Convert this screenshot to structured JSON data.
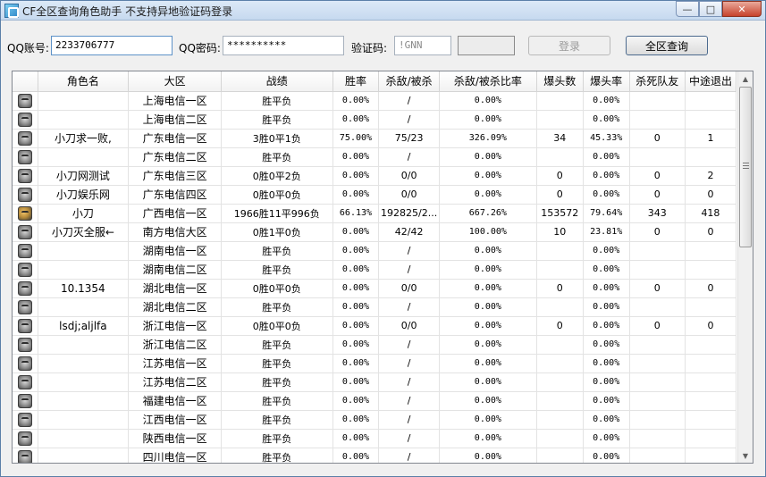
{
  "window": {
    "title": "CF全区查询角色助手 不支持异地验证码登录",
    "minimize": "—",
    "maximize": "□",
    "close": "✕"
  },
  "login": {
    "qq_label": "QQ账号:",
    "qq_value": "2233706777",
    "password_label": "QQ密码:",
    "password_value": "**********",
    "captcha_label": "验证码:",
    "captcha_value": "!GNN",
    "login_button": "登录",
    "query_button": "全区查询"
  },
  "table": {
    "columns": [
      "",
      "角色名",
      "大区",
      "战绩",
      "胜率",
      "杀敌/被杀",
      "杀敌/被杀比率",
      "爆头数",
      "爆头率",
      "杀死队友",
      "中途退出"
    ],
    "rows": [
      {
        "name": "",
        "region": "上海电信一区",
        "record": "胜平负",
        "win": "0.00%",
        "kd": "/",
        "kdr": "0.00%",
        "hs": "",
        "hsr": "0.00%",
        "tk": "",
        "quit": ""
      },
      {
        "name": "",
        "region": "上海电信二区",
        "record": "胜平负",
        "win": "0.00%",
        "kd": "/",
        "kdr": "0.00%",
        "hs": "",
        "hsr": "0.00%",
        "tk": "",
        "quit": ""
      },
      {
        "name": "小刀求一败,",
        "region": "广东电信一区",
        "record": "3胜0平1负",
        "win": "75.00%",
        "kd": "75/23",
        "kdr": "326.09%",
        "hs": "34",
        "hsr": "45.33%",
        "tk": "0",
        "quit": "1"
      },
      {
        "name": "",
        "region": "广东电信二区",
        "record": "胜平负",
        "win": "0.00%",
        "kd": "/",
        "kdr": "0.00%",
        "hs": "",
        "hsr": "0.00%",
        "tk": "",
        "quit": ""
      },
      {
        "name": "小刀网测试",
        "region": "广东电信三区",
        "record": "0胜0平2负",
        "win": "0.00%",
        "kd": "0/0",
        "kdr": "0.00%",
        "hs": "0",
        "hsr": "0.00%",
        "tk": "0",
        "quit": "2"
      },
      {
        "name": "小刀娱乐网",
        "region": "广东电信四区",
        "record": "0胜0平0负",
        "win": "0.00%",
        "kd": "0/0",
        "kdr": "0.00%",
        "hs": "0",
        "hsr": "0.00%",
        "tk": "0",
        "quit": "0"
      },
      {
        "name": "小刀",
        "region": "广西电信一区",
        "record": "1966胜11平996负",
        "win": "66.13%",
        "kd": "192825/2...",
        "kdr": "667.26%",
        "hs": "153572",
        "hsr": "79.64%",
        "tk": "343",
        "quit": "418",
        "special": true
      },
      {
        "name": "小刀灭全服←",
        "region": "南方电信大区",
        "record": "0胜1平0负",
        "win": "0.00%",
        "kd": "42/42",
        "kdr": "100.00%",
        "hs": "10",
        "hsr": "23.81%",
        "tk": "0",
        "quit": "0"
      },
      {
        "name": "",
        "region": "湖南电信一区",
        "record": "胜平负",
        "win": "0.00%",
        "kd": "/",
        "kdr": "0.00%",
        "hs": "",
        "hsr": "0.00%",
        "tk": "",
        "quit": ""
      },
      {
        "name": "",
        "region": "湖南电信二区",
        "record": "胜平负",
        "win": "0.00%",
        "kd": "/",
        "kdr": "0.00%",
        "hs": "",
        "hsr": "0.00%",
        "tk": "",
        "quit": ""
      },
      {
        "name": "10.1354",
        "region": "湖北电信一区",
        "record": "0胜0平0负",
        "win": "0.00%",
        "kd": "0/0",
        "kdr": "0.00%",
        "hs": "0",
        "hsr": "0.00%",
        "tk": "0",
        "quit": "0"
      },
      {
        "name": "",
        "region": "湖北电信二区",
        "record": "胜平负",
        "win": "0.00%",
        "kd": "/",
        "kdr": "0.00%",
        "hs": "",
        "hsr": "0.00%",
        "tk": "",
        "quit": ""
      },
      {
        "name": "lsdj;aljlfa",
        "region": "浙江电信一区",
        "record": "0胜0平0负",
        "win": "0.00%",
        "kd": "0/0",
        "kdr": "0.00%",
        "hs": "0",
        "hsr": "0.00%",
        "tk": "0",
        "quit": "0"
      },
      {
        "name": "",
        "region": "浙江电信二区",
        "record": "胜平负",
        "win": "0.00%",
        "kd": "/",
        "kdr": "0.00%",
        "hs": "",
        "hsr": "0.00%",
        "tk": "",
        "quit": ""
      },
      {
        "name": "",
        "region": "江苏电信一区",
        "record": "胜平负",
        "win": "0.00%",
        "kd": "/",
        "kdr": "0.00%",
        "hs": "",
        "hsr": "0.00%",
        "tk": "",
        "quit": ""
      },
      {
        "name": "",
        "region": "江苏电信二区",
        "record": "胜平负",
        "win": "0.00%",
        "kd": "/",
        "kdr": "0.00%",
        "hs": "",
        "hsr": "0.00%",
        "tk": "",
        "quit": ""
      },
      {
        "name": "",
        "region": "福建电信一区",
        "record": "胜平负",
        "win": "0.00%",
        "kd": "/",
        "kdr": "0.00%",
        "hs": "",
        "hsr": "0.00%",
        "tk": "",
        "quit": ""
      },
      {
        "name": "",
        "region": "江西电信一区",
        "record": "胜平负",
        "win": "0.00%",
        "kd": "/",
        "kdr": "0.00%",
        "hs": "",
        "hsr": "0.00%",
        "tk": "",
        "quit": ""
      },
      {
        "name": "",
        "region": "陕西电信一区",
        "record": "胜平负",
        "win": "0.00%",
        "kd": "/",
        "kdr": "0.00%",
        "hs": "",
        "hsr": "0.00%",
        "tk": "",
        "quit": ""
      },
      {
        "name": "",
        "region": "四川电信一区",
        "record": "胜平负",
        "win": "0.00%",
        "kd": "/",
        "kdr": "0.00%",
        "hs": "",
        "hsr": "0.00%",
        "tk": "",
        "quit": ""
      }
    ]
  },
  "icons": {
    "app": "app-icon",
    "row_avatar": "avatar-icon",
    "scroll_up": "▲",
    "scroll_down": "▼"
  }
}
